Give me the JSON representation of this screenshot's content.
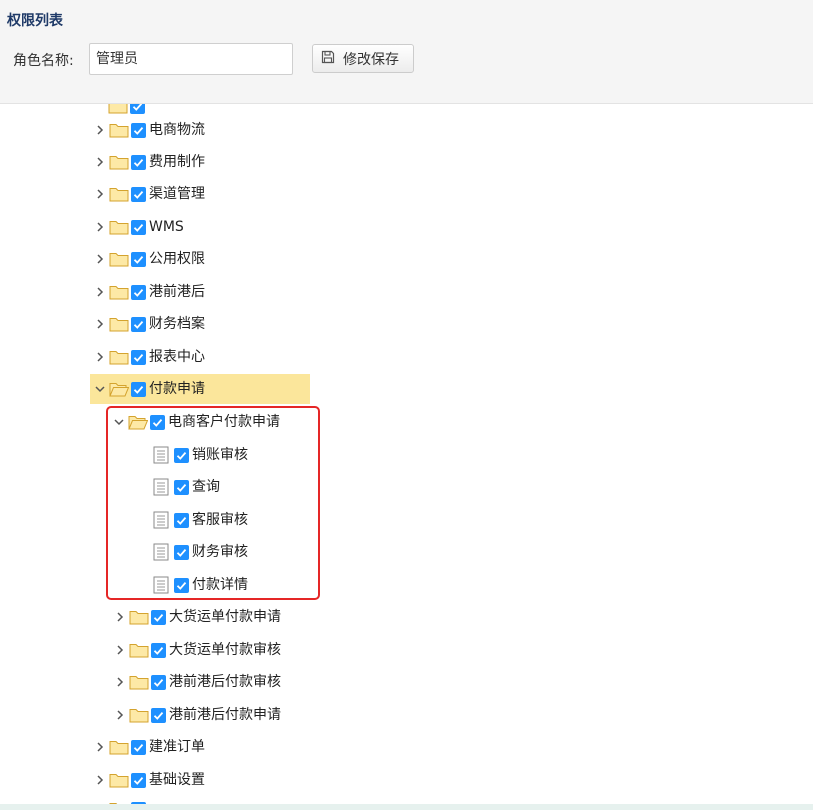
{
  "header": {
    "title": "权限列表",
    "role_label": "角色名称:",
    "role_value": "管理员",
    "save_label": "修改保存"
  },
  "tree": {
    "nodes": [
      {
        "label": "电商物流",
        "type": "folder",
        "expanded": false,
        "checked": true
      },
      {
        "label": "费用制作",
        "type": "folder",
        "expanded": false,
        "checked": true
      },
      {
        "label": "渠道管理",
        "type": "folder",
        "expanded": false,
        "checked": true
      },
      {
        "label": "WMS",
        "type": "folder",
        "expanded": false,
        "checked": true
      },
      {
        "label": "公用权限",
        "type": "folder",
        "expanded": false,
        "checked": true
      },
      {
        "label": "港前港后",
        "type": "folder",
        "expanded": false,
        "checked": true
      },
      {
        "label": "财务档案",
        "type": "folder",
        "expanded": false,
        "checked": true
      },
      {
        "label": "报表中心",
        "type": "folder",
        "expanded": false,
        "checked": true
      },
      {
        "label": "付款申请",
        "type": "folder",
        "expanded": true,
        "checked": true,
        "selected": true
      },
      {
        "label": "电商客户付款申请",
        "type": "folder",
        "expanded": true,
        "checked": true
      },
      {
        "label": "销账审核",
        "type": "file",
        "checked": true
      },
      {
        "label": "查询",
        "type": "file",
        "checked": true
      },
      {
        "label": "客服审核",
        "type": "file",
        "checked": true
      },
      {
        "label": "财务审核",
        "type": "file",
        "checked": true
      },
      {
        "label": "付款详情",
        "type": "file",
        "checked": true
      },
      {
        "label": "大货运单付款申请",
        "type": "folder",
        "expanded": false,
        "checked": true
      },
      {
        "label": "大货运单付款审核",
        "type": "folder",
        "expanded": false,
        "checked": true
      },
      {
        "label": "港前港后付款审核",
        "type": "folder",
        "expanded": false,
        "checked": true
      },
      {
        "label": "港前港后付款申请",
        "type": "folder",
        "expanded": false,
        "checked": true
      },
      {
        "label": "建准订单",
        "type": "folder",
        "expanded": false,
        "checked": true
      },
      {
        "label": "基础设置",
        "type": "folder",
        "expanded": false,
        "checked": true
      }
    ]
  },
  "colors": {
    "checkbox": "#1e90ff",
    "selected_row": "#fbe69b",
    "highlight_border": "#e52626",
    "folder_fill": "#fde9a6",
    "folder_stroke": "#d4a32e"
  }
}
